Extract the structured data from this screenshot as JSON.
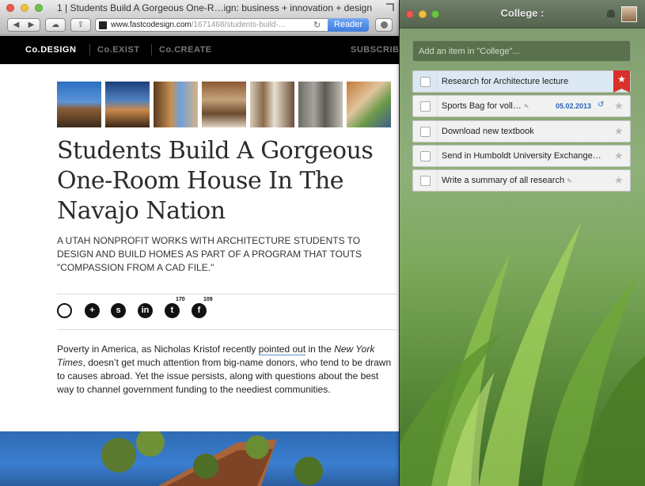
{
  "safari": {
    "title": "1 | Students Build A Gorgeous One-R…ign: business + innovation + design",
    "url_host": "www.fastcodesign.com",
    "url_path": "/1671468/students-build-…",
    "reader_label": "Reader",
    "nav": {
      "codesign": "Co.DESIGN",
      "coexist": "Co.EXIST",
      "cocreate": "Co.CREATE",
      "subscribe": "SUBSCRIBE"
    },
    "article": {
      "headline": "Students Build A Gorgeous One-Room House In The Navajo Nation",
      "dek": "A Utah nonprofit works with architecture students to design and build homes as part of a program that touts \"compassion from a CAD file.\"",
      "share": {
        "twitter_count": "170",
        "facebook_count": "109"
      },
      "body": {
        "p1": "Poverty in America, as Nicholas Kristof recently ",
        "link": "pointed out",
        "p2": " in the ",
        "em": "New York Times",
        "p3": ", doesn’t get much attention from big-name donors, who tend to be drawn to causes abroad. Yet the issue persists, along with questions about the best way to channel government funding to the neediest communities."
      }
    }
  },
  "wunderlist": {
    "list_name": "College :",
    "add_placeholder": "Add an item in \"College\"...",
    "tasks": [
      {
        "title": "Research for Architecture lecture",
        "starred": true
      },
      {
        "title": "Sports Bag for voll…",
        "date": "05.02.2013",
        "pinned": true
      },
      {
        "title": "Download new textbook"
      },
      {
        "title": "Send in Humboldt University Exchange…"
      },
      {
        "title": "Write a summary of all research",
        "pinned": true
      }
    ]
  },
  "colors": {
    "reader_blue": "#3e7de0",
    "date_blue": "#2a63b8",
    "star_red": "#d8302a"
  }
}
